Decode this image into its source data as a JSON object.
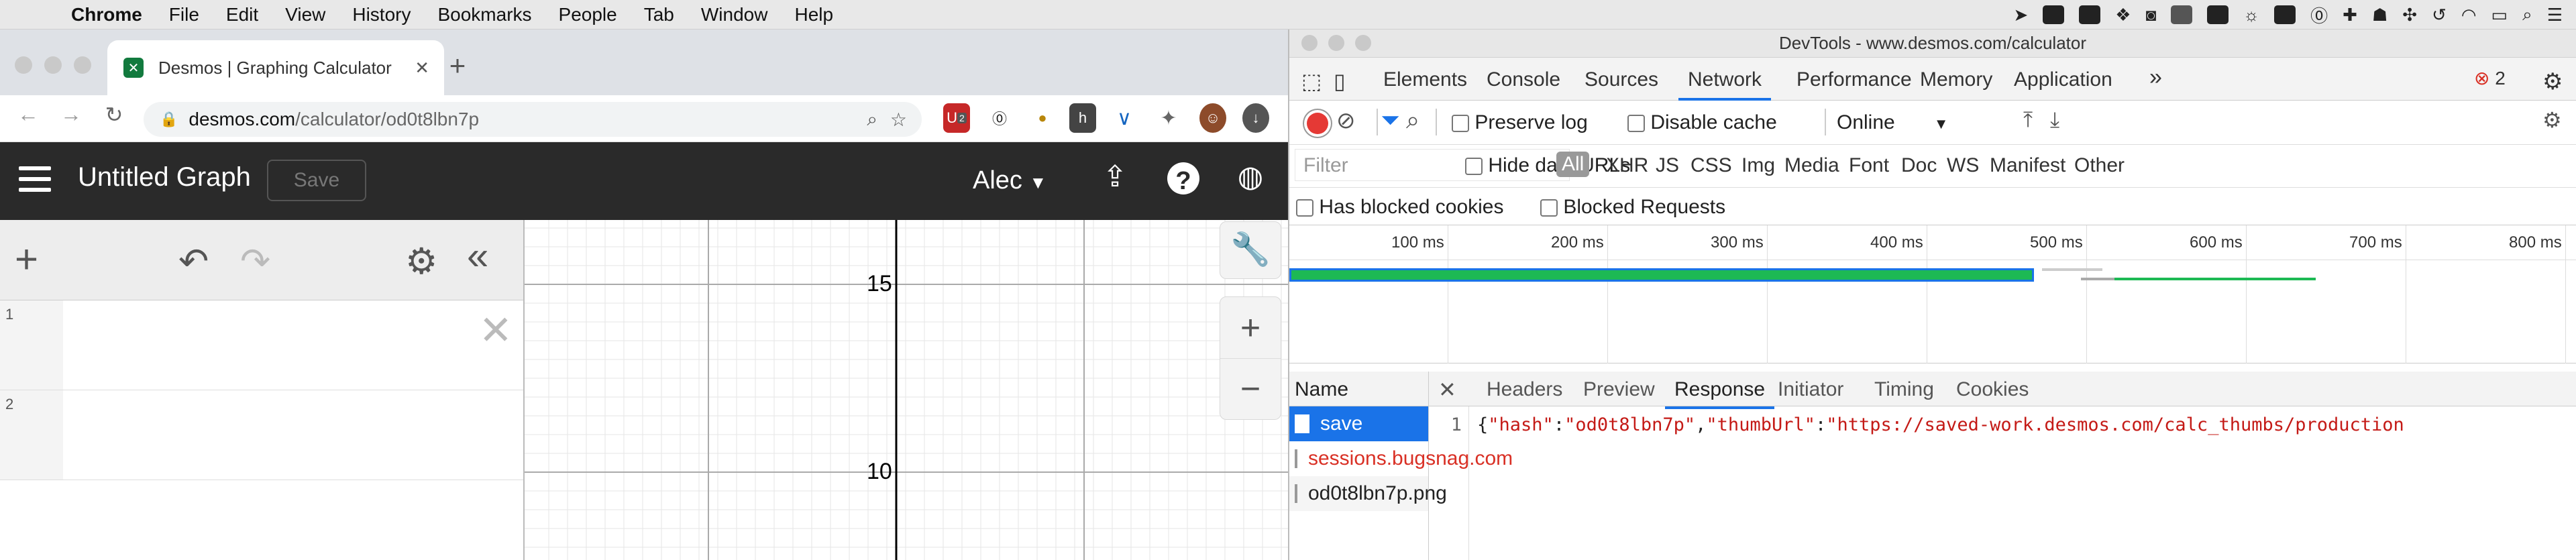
{
  "menubar": {
    "app": "Chrome",
    "items": [
      "File",
      "Edit",
      "View",
      "History",
      "Bookmarks",
      "People",
      "Tab",
      "Window",
      "Help"
    ]
  },
  "browser": {
    "tab_title": "Desmos | Graphing Calculator",
    "url_host": "desmos.com",
    "url_path": "/calculator/od0t8lbn7p",
    "new_tab_glyph": "+",
    "ext_badge": "2"
  },
  "desmos": {
    "graph_title": "Untitled Graph",
    "save_label": "Save",
    "user": "Alec",
    "expressions": [
      {
        "num": "1"
      },
      {
        "num": "2"
      }
    ],
    "axis_labels": [
      "15",
      "10"
    ]
  },
  "devtools": {
    "title": "DevTools - www.desmos.com/calculator",
    "tabs": [
      "Elements",
      "Console",
      "Sources",
      "Network",
      "Performance",
      "Memory",
      "Application"
    ],
    "active_tab": "Network",
    "error_count": "2",
    "toolbar": {
      "preserve_log": "Preserve log",
      "disable_cache": "Disable cache",
      "throttle": "Online"
    },
    "filter": {
      "placeholder": "Filter",
      "hide_data_urls": "Hide data URLs",
      "types": [
        "All",
        "XHR",
        "JS",
        "CSS",
        "Img",
        "Media",
        "Font",
        "Doc",
        "WS",
        "Manifest",
        "Other"
      ]
    },
    "blocked": {
      "has_blocked_cookies": "Has blocked cookies",
      "blocked_requests": "Blocked Requests"
    },
    "timeline_labels": [
      "100 ms",
      "200 ms",
      "300 ms",
      "400 ms",
      "500 ms",
      "600 ms",
      "700 ms",
      "800 ms"
    ],
    "requests_header": "Name",
    "requests": [
      {
        "name": "save",
        "state": "selected"
      },
      {
        "name": "sessions.bugsnag.com",
        "state": "fail"
      },
      {
        "name": "od0t8lbn7p.png",
        "state": "normal"
      }
    ],
    "detail_tabs": [
      "Headers",
      "Preview",
      "Response",
      "Initiator",
      "Timing",
      "Cookies"
    ],
    "active_detail_tab": "Response",
    "response": {
      "line_no": "1",
      "k1": "\"hash\"",
      "v1": "\"od0t8lbn7p\"",
      "k2": "\"thumbUrl\"",
      "v2": "\"https://saved-work.desmos.com/calc_thumbs/production"
    }
  },
  "colors": {
    "desmos_header": "#2a2a2a",
    "devtools_accent": "#1a73e8",
    "record": "#e53935",
    "error": "#d93025",
    "waterfall_green": "#1db954",
    "waterfall_blue": "#1a73e8"
  }
}
